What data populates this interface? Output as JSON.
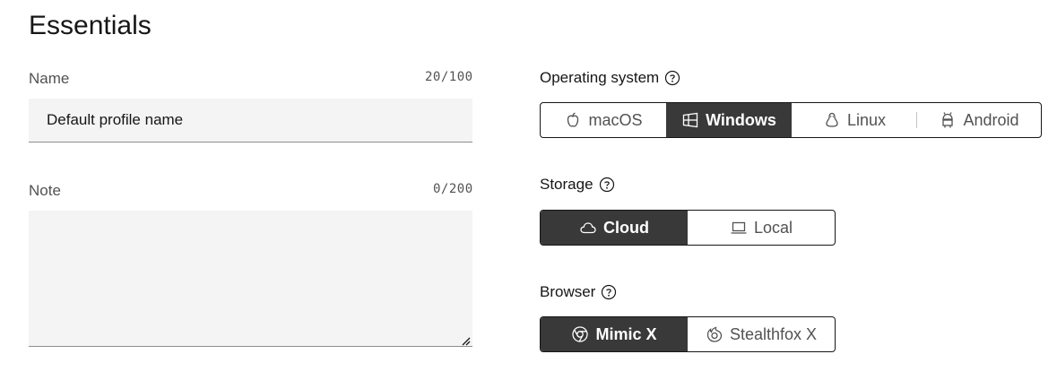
{
  "section_title": "Essentials",
  "name": {
    "label": "Name",
    "counter": "20/100",
    "value": "Default profile name"
  },
  "note": {
    "label": "Note",
    "counter": "0/200",
    "value": ""
  },
  "os": {
    "label": "Operating system",
    "options": [
      {
        "label": "macOS",
        "icon": "apple-icon",
        "selected": false
      },
      {
        "label": "Windows",
        "icon": "windows-icon",
        "selected": true
      },
      {
        "label": "Linux",
        "icon": "linux-icon",
        "selected": false
      },
      {
        "label": "Android",
        "icon": "android-icon",
        "selected": false
      }
    ]
  },
  "storage": {
    "label": "Storage",
    "options": [
      {
        "label": "Cloud",
        "icon": "cloud-icon",
        "selected": true
      },
      {
        "label": "Local",
        "icon": "laptop-icon",
        "selected": false
      }
    ]
  },
  "browser": {
    "label": "Browser",
    "options": [
      {
        "label": "Mimic X",
        "icon": "chromium-icon",
        "selected": true
      },
      {
        "label": "Stealthfox X",
        "icon": "firefox-icon",
        "selected": false
      }
    ]
  },
  "colors": {
    "selected_bg": "#393939",
    "border": "#161616",
    "field_bg": "#f4f4f4",
    "muted_text": "#525252"
  }
}
